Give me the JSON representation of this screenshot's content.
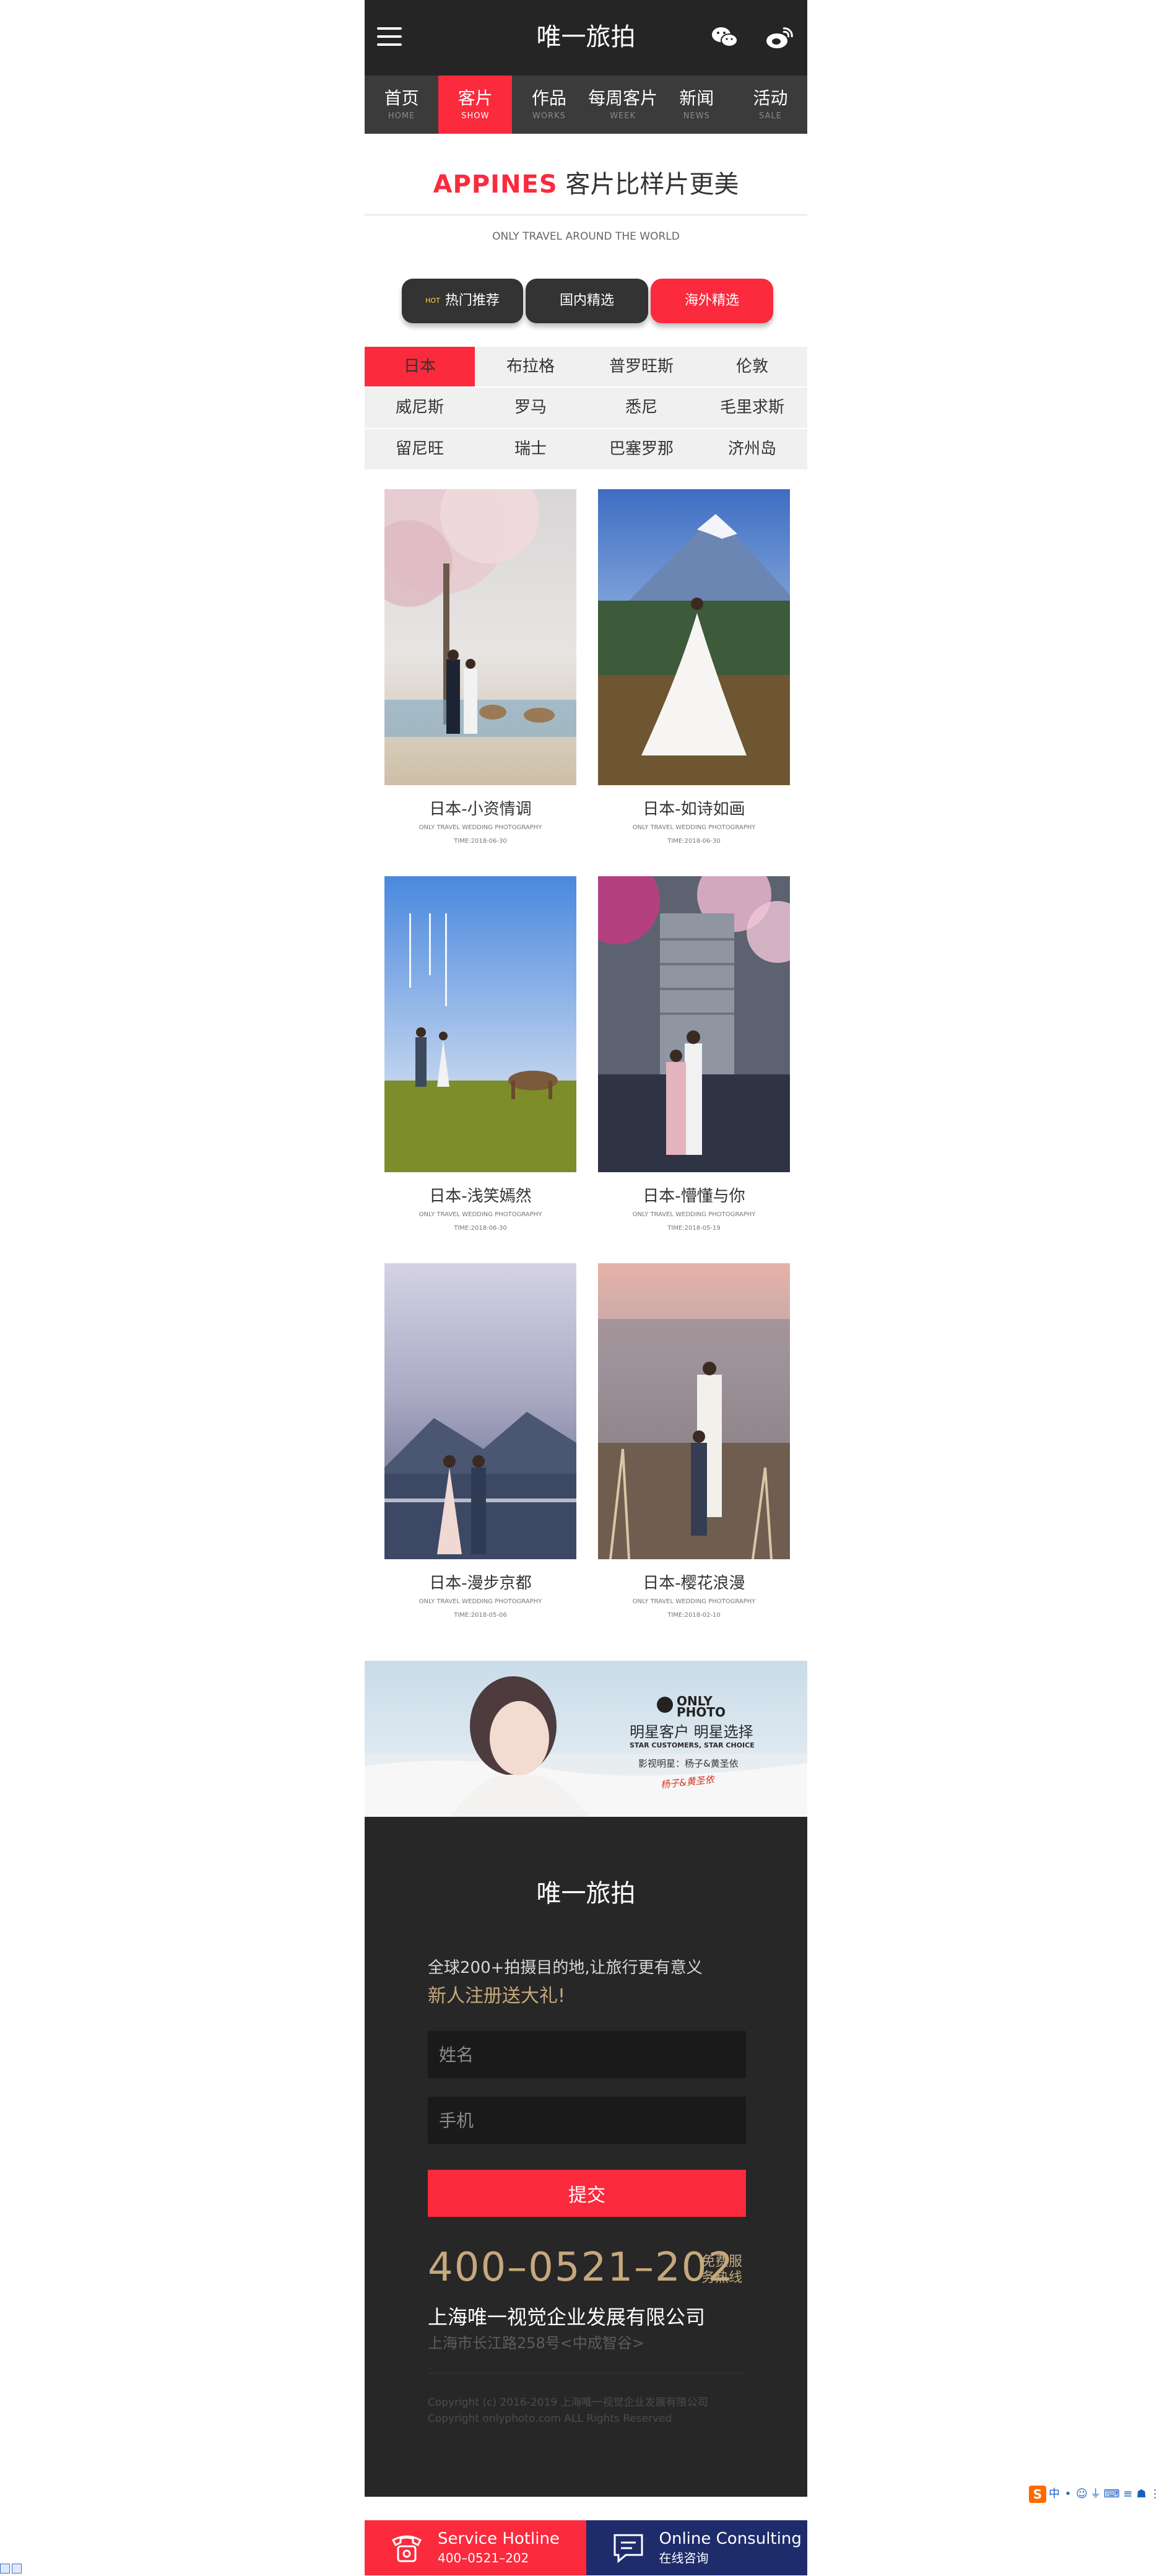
{
  "header": {
    "site_title": "唯一旅拍"
  },
  "nav": [
    {
      "cn": "首页",
      "en": "HOME",
      "active": false
    },
    {
      "cn": "客片",
      "en": "SHOW",
      "active": true
    },
    {
      "cn": "作品",
      "en": "WORKS",
      "active": false
    },
    {
      "cn": "每周客片",
      "en": "WEEK",
      "active": false
    },
    {
      "cn": "新闻",
      "en": "NEWS",
      "active": false
    },
    {
      "cn": "活动",
      "en": "SALE",
      "active": false
    }
  ],
  "headline": {
    "brand": "APPINES",
    "text": "客片比样片更美",
    "subtitle": "ONLY TRAVEL AROUND THE WORLD"
  },
  "tabs": {
    "hot_badge": "HOT",
    "hot": "热门推荐",
    "domestic": "国内精选",
    "overseas": "海外精选"
  },
  "cities": [
    "日本",
    "布拉格",
    "普罗旺斯",
    "伦敦",
    "威尼斯",
    "罗马",
    "悉尼",
    "毛里求斯",
    "留尼旺",
    "瑞士",
    "巴塞罗那",
    "济州岛"
  ],
  "cards": [
    {
      "title": "日本-小资情调",
      "en": "ONLY TRAVEL WEDDING PHOTOGRAPHY",
      "time": "TIME:2018-06-30"
    },
    {
      "title": "日本-如诗如画",
      "en": "ONLY TRAVEL WEDDING PHOTOGRAPHY",
      "time": "TIME:2018-06-30"
    },
    {
      "title": "日本-浅笑嫣然",
      "en": "ONLY TRAVEL WEDDING PHOTOGRAPHY",
      "time": "TIME:2018-06-30"
    },
    {
      "title": "日本-懵懂与你",
      "en": "ONLY TRAVEL WEDDING PHOTOGRAPHY",
      "time": "TIME:2018-05-19"
    },
    {
      "title": "日本-漫步京都",
      "en": "ONLY TRAVEL WEDDING PHOTOGRAPHY",
      "time": "TIME:2018-05-06"
    },
    {
      "title": "日本-樱花浪漫",
      "en": "ONLY TRAVEL WEDDING PHOTOGRAPHY",
      "time": "TIME:2018-02-10"
    }
  ],
  "banner": {
    "logo_top": "ONLY",
    "logo_bottom": "PHOTO",
    "slogan_cn": "明星客户 明星选择",
    "slogan_en": "STAR CUSTOMERS, STAR CHOICE",
    "star": "影视明星：杨子&黄圣依",
    "signature": "杨子&黄圣依"
  },
  "footer": {
    "title": "唯一旅拍",
    "promo_line1": "全球200+拍摄目的地,让旅行更有意义",
    "promo_line2": "新人注册送大礼!",
    "name_placeholder": "姓名",
    "phone_placeholder": "手机",
    "submit": "提交",
    "hotline": "400–0521–202",
    "hotline_note": "免费服务热线",
    "company": "上海唯一视觉企业发展有限公司",
    "address": "上海市长江路258号<中成智谷>",
    "copyright1": "Copyright (c) 2016-2019 上海唯一视觉企业发展有限公司",
    "copyright2": "Copyright onlyphoto.com ALL Rights Reserved"
  },
  "bottom_bar": {
    "hotline_title": "Service Hotline",
    "hotline_number": "400–0521–202",
    "consult_title": "Online Consulting",
    "consult_sub": "在线咨询"
  },
  "ime_toolbar": {
    "logo": "S",
    "items": [
      "中",
      "•",
      "☺",
      "⏚",
      "⌨",
      "≡",
      "☗",
      "⋮"
    ]
  },
  "colors": {
    "accent": "#fb2a3d",
    "dark": "#272727",
    "nav": "#3b3b3b",
    "gold": "#c6a87d",
    "navy": "#1f2c6b"
  }
}
